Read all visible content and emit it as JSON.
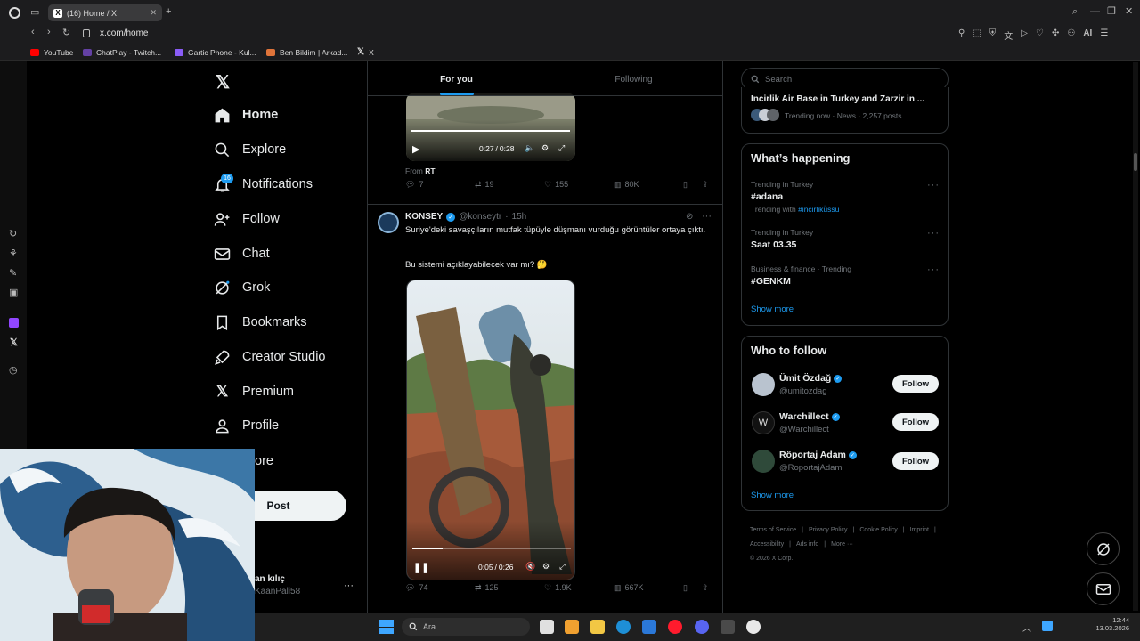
{
  "browser": {
    "tab_title": "(16) Home / X",
    "url": "x.com/home",
    "ai_label": "AI",
    "bookmarks": [
      {
        "label": "YouTube",
        "color": "#ff0000"
      },
      {
        "label": "ChatPlay - Twitch...",
        "color": "#6441a5"
      },
      {
        "label": "Gartic Phone - Kul...",
        "color": "#8a5cf6"
      },
      {
        "label": "Ben Bildim | Arkad...",
        "color": "#e0743a"
      },
      {
        "label": "X",
        "color": "#ffffff"
      }
    ]
  },
  "nav": {
    "items": [
      {
        "label": "Home",
        "icon": "home-icon"
      },
      {
        "label": "Explore",
        "icon": "search-icon"
      },
      {
        "label": "Notifications",
        "icon": "bell-icon",
        "badge": "16"
      },
      {
        "label": "Follow",
        "icon": "person-plus-icon"
      },
      {
        "label": "Chat",
        "icon": "mail-icon"
      },
      {
        "label": "Grok",
        "icon": "grok-icon"
      },
      {
        "label": "Bookmarks",
        "icon": "bookmark-icon"
      },
      {
        "label": "Creator Studio",
        "icon": "rocket-icon"
      },
      {
        "label": "Premium",
        "icon": "x-logo-icon"
      },
      {
        "label": "Profile",
        "icon": "person-icon"
      },
      {
        "label": "ore",
        "icon": "more-icon"
      }
    ],
    "post_label": "Post",
    "account_name": "an kılıç",
    "account_handle": "KaanPali58"
  },
  "feed": {
    "tabs": [
      "For you",
      "Following"
    ],
    "post1": {
      "time_current": "0:27",
      "time_total": "0:28",
      "from_prefix": "From ",
      "from_source": "RT",
      "replies": "7",
      "reposts": "19",
      "likes": "155",
      "views": "80K"
    },
    "post2": {
      "author": "KONSEY",
      "handle": "@konseytr",
      "time": "15h",
      "text1": "Suriye'deki savaşçıların mutfak tüpüyle düşmanı vurduğu görüntüler ortaya çıktı.",
      "text2": "Bu sistemi açıklayabilecek var mı? 🤔",
      "time_current": "0:05",
      "time_total": "0:26",
      "progress": 0.19,
      "replies": "74",
      "reposts": "125",
      "likes": "1.9K",
      "views": "667K"
    }
  },
  "right": {
    "search_placeholder": "Search",
    "top_trend": {
      "title": "Incirlik Air Base in Turkey and Zarzir in ...",
      "meta": "Trending now · News · 2,257 posts"
    },
    "happening_title": "What’s happening",
    "trends": [
      {
        "context": "Trending in Turkey",
        "name": "#adana",
        "with_prefix": "Trending with ",
        "with_tag": "#incirlikü̈ssü"
      },
      {
        "context": "Trending in Turkey",
        "name": "Saat 03.35"
      },
      {
        "context": "Business & finance · Trending",
        "name": "#GENKM"
      }
    ],
    "show_more": "Show more",
    "who_title": "Who to follow",
    "who": [
      {
        "name": "Ümit Özdağ",
        "handle": "@umitozdag",
        "button": "Follow"
      },
      {
        "name": "Warchillect",
        "handle": "@Warchillect",
        "button": "Follow"
      },
      {
        "name": "Röportaj Adam",
        "handle": "@RoportajAdam",
        "button": "Follow"
      }
    ],
    "who_show_more": "Show more",
    "footer": [
      "Terms of Service",
      "|",
      "Privacy Policy",
      "|",
      "Cookie Policy",
      "|",
      "Imprint",
      "|",
      "Accessibility",
      "|",
      "Ads info",
      "|",
      "More ···"
    ],
    "copyright": "© 2026 X Corp."
  },
  "taskbar": {
    "search_placeholder": "Ara",
    "clock_time": "12:44",
    "clock_date": "13.03.2026"
  },
  "colors": {
    "accent": "#1d9bf0",
    "bg": "#000000",
    "border": "#2f3336",
    "muted": "#71767b"
  }
}
